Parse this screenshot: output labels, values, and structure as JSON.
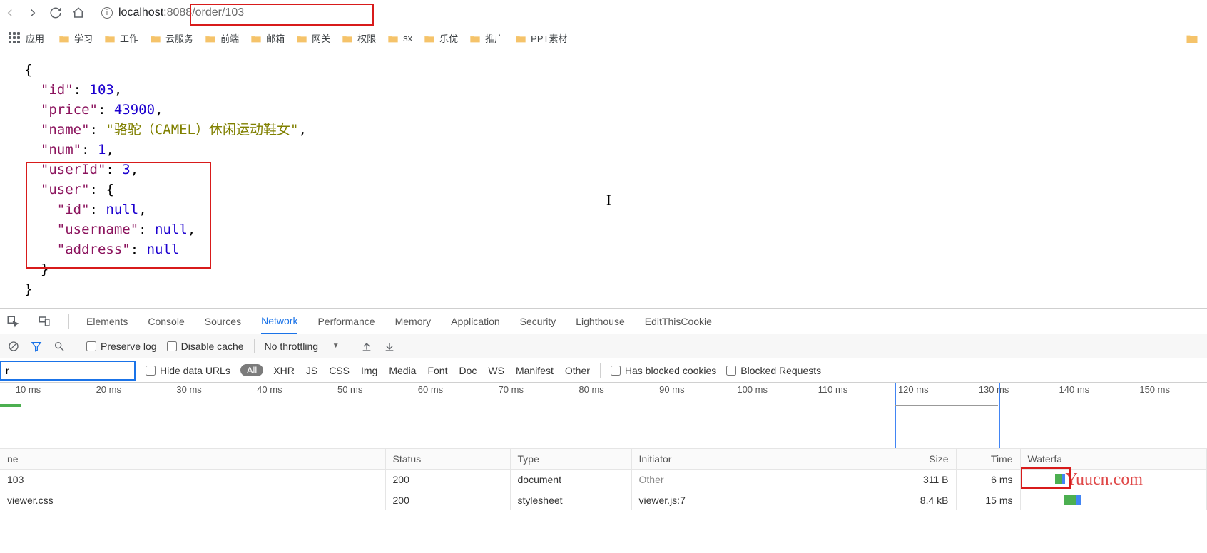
{
  "browser": {
    "url_host": "localhost",
    "url_port_path": ":8088/order/103"
  },
  "bookmarks": {
    "apps_label": "应用",
    "items": [
      "学习",
      "工作",
      "云服务",
      "前端",
      "邮箱",
      "网关",
      "权限",
      "sx",
      "乐优",
      "推广",
      "PPT素材"
    ]
  },
  "json_body": {
    "id_key": "\"id\"",
    "id_val": "103",
    "price_key": "\"price\"",
    "price_val": "43900",
    "name_key": "\"name\"",
    "name_val": "\"骆驼（CAMEL）休闲运动鞋女\"",
    "num_key": "\"num\"",
    "num_val": "1",
    "userId_key": "\"userId\"",
    "userId_val": "3",
    "user_key": "\"user\"",
    "user_id_key": "\"id\"",
    "user_id_val": "null",
    "username_key": "\"username\"",
    "username_val": "null",
    "address_key": "\"address\"",
    "address_val": "null"
  },
  "devtools": {
    "tabs": [
      "Elements",
      "Console",
      "Sources",
      "Network",
      "Performance",
      "Memory",
      "Application",
      "Security",
      "Lighthouse",
      "EditThisCookie"
    ],
    "active_tab": "Network"
  },
  "net_toolbar": {
    "preserve_log": "Preserve log",
    "disable_cache": "Disable cache",
    "throttling": "No throttling"
  },
  "net_filter": {
    "input_value": "r",
    "hide_data_urls": "Hide data URLs",
    "all": "All",
    "types": [
      "XHR",
      "JS",
      "CSS",
      "Img",
      "Media",
      "Font",
      "Doc",
      "WS",
      "Manifest",
      "Other"
    ],
    "has_blocked": "Has blocked cookies",
    "blocked_requests": "Blocked Requests"
  },
  "timeline": {
    "ticks": [
      "10 ms",
      "20 ms",
      "30 ms",
      "40 ms",
      "50 ms",
      "60 ms",
      "70 ms",
      "80 ms",
      "90 ms",
      "100 ms",
      "110 ms",
      "120 ms",
      "130 ms",
      "140 ms",
      "150 ms"
    ]
  },
  "net_table": {
    "headers": {
      "name": "ne",
      "status": "Status",
      "type": "Type",
      "initiator": "Initiator",
      "size": "Size",
      "time": "Time",
      "waterfall": "Waterfa"
    },
    "rows": [
      {
        "name": "103",
        "status": "200",
        "type": "document",
        "initiator": "Other",
        "initiator_kind": "other",
        "size": "311 B",
        "time": "6 ms"
      },
      {
        "name": "viewer.css",
        "status": "200",
        "type": "stylesheet",
        "initiator": "viewer.js:7",
        "initiator_kind": "link",
        "size": "8.4 kB",
        "time": "15 ms"
      }
    ]
  },
  "watermark": "Yuucn.com"
}
